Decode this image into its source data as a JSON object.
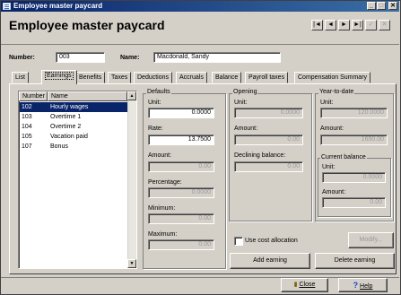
{
  "window": {
    "title": "Employee master paycard"
  },
  "header": {
    "title": "Employee master paycard",
    "nav": [
      "|◄",
      "◄",
      "►",
      "►|",
      "✓",
      "✕"
    ]
  },
  "employee": {
    "number_label": "Number:",
    "number_value": "003",
    "name_label": "Name:",
    "name_value": "Macdonald, Sandy"
  },
  "tabs": [
    "List",
    "Earnings",
    "Benefits",
    "Taxes",
    "Deductions",
    "Accruals",
    "Balance",
    "Payroll taxes",
    "Compensation Summary"
  ],
  "active_tab": "Earnings",
  "earnings_list": {
    "col_number": "Number",
    "col_name": "Name",
    "rows": [
      {
        "number": "102",
        "name": "Hourly wages",
        "selected": true
      },
      {
        "number": "103",
        "name": "Overtime 1",
        "selected": false
      },
      {
        "number": "104",
        "name": "Overtime 2",
        "selected": false
      },
      {
        "number": "105",
        "name": "Vacation paid",
        "selected": false
      },
      {
        "number": "107",
        "name": "Bonus",
        "selected": false
      }
    ]
  },
  "defaults": {
    "title": "Defaults",
    "unit_label": "Unit:",
    "unit_value": "0.0000",
    "rate_label": "Rate:",
    "rate_value": "13.7500",
    "amount_label": "Amount:",
    "amount_value": "0.00",
    "percentage_label": "Percentage:",
    "percentage_value": "0.0000",
    "minimum_label": "Minimum:",
    "minimum_value": "0.00",
    "maximum_label": "Maximum:",
    "maximum_value": "0.00"
  },
  "opening": {
    "title": "Opening",
    "unit_label": "Unit:",
    "unit_value": "0.0000",
    "amount_label": "Amount:",
    "amount_value": "0.00",
    "declining_label": "Declining balance:",
    "declining_value": "0.00"
  },
  "ytd": {
    "title": "Year-to-date",
    "unit_label": "Unit:",
    "unit_value": "120.0000",
    "amount_label": "Amount:",
    "amount_value": "1650.00"
  },
  "current_balance": {
    "title": "Current balance",
    "unit_label": "Unit:",
    "unit_value": "0.0000",
    "amount_label": "Amount:",
    "amount_value": "0.00"
  },
  "use_cost_allocation_label": "Use cost allocation",
  "buttons": {
    "modify": "Modify...",
    "add_earning": "Add earning",
    "delete_earning": "Delete earning",
    "close": "Close",
    "help": "Help"
  },
  "colors": {
    "selection": "#0a246a",
    "title_bar": "#0a246a",
    "face": "#d4d0c8"
  }
}
